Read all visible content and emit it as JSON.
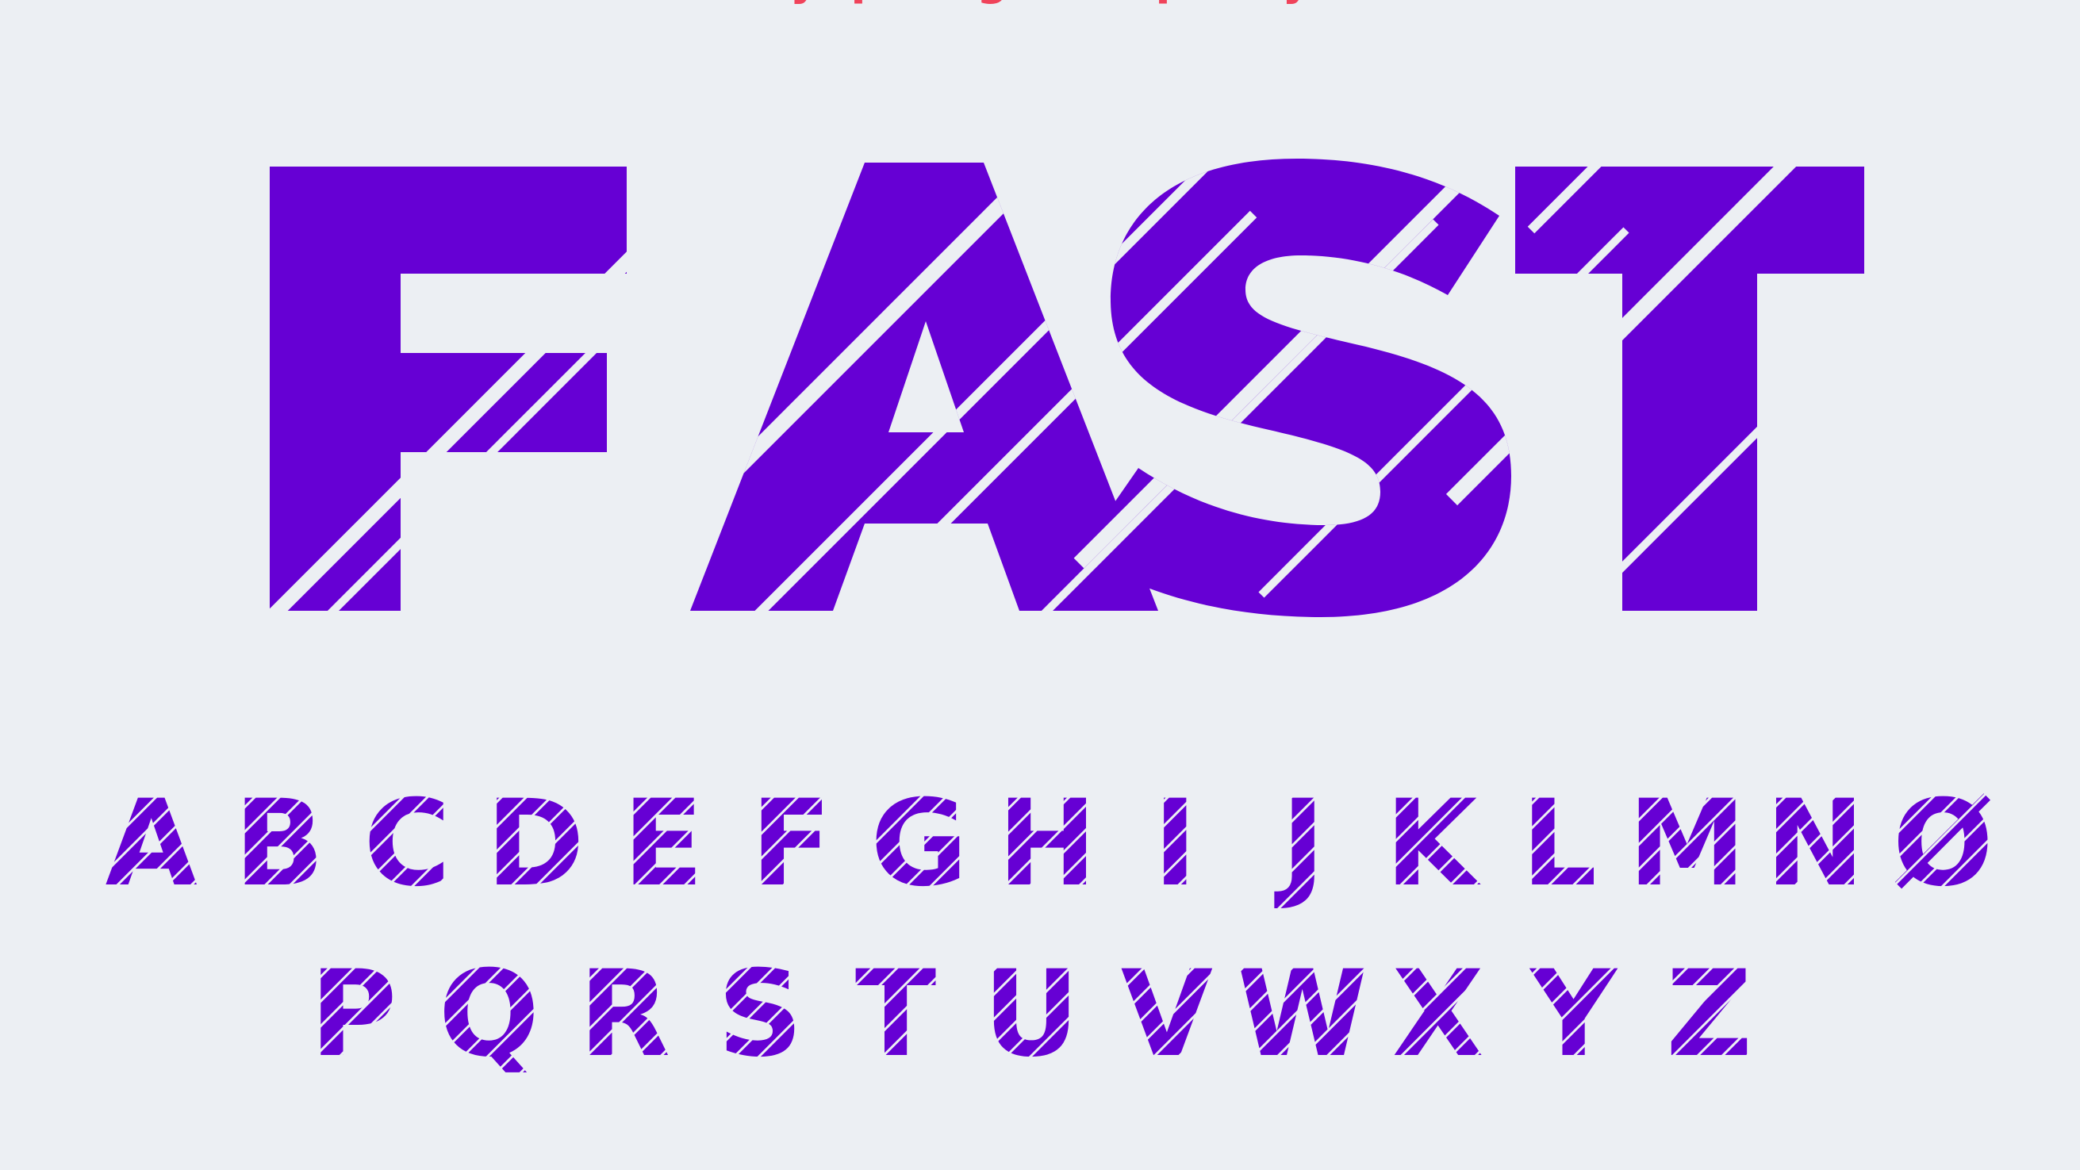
{
  "colors": {
    "background": "#ECEFF3",
    "letter": "#6600D4",
    "caption": "#F0435A"
  },
  "caption": "typography",
  "hero": {
    "word": "FAST"
  },
  "alphabet": {
    "row_1": [
      "A",
      "B",
      "C",
      "D",
      "E",
      "F",
      "G",
      "H",
      "I",
      "J",
      "K",
      "L",
      "M",
      "N",
      "Ø"
    ],
    "row_2": [
      "P",
      "Q",
      "R",
      "S",
      "T",
      "U",
      "V",
      "W",
      "X",
      "Y",
      "Z"
    ]
  }
}
